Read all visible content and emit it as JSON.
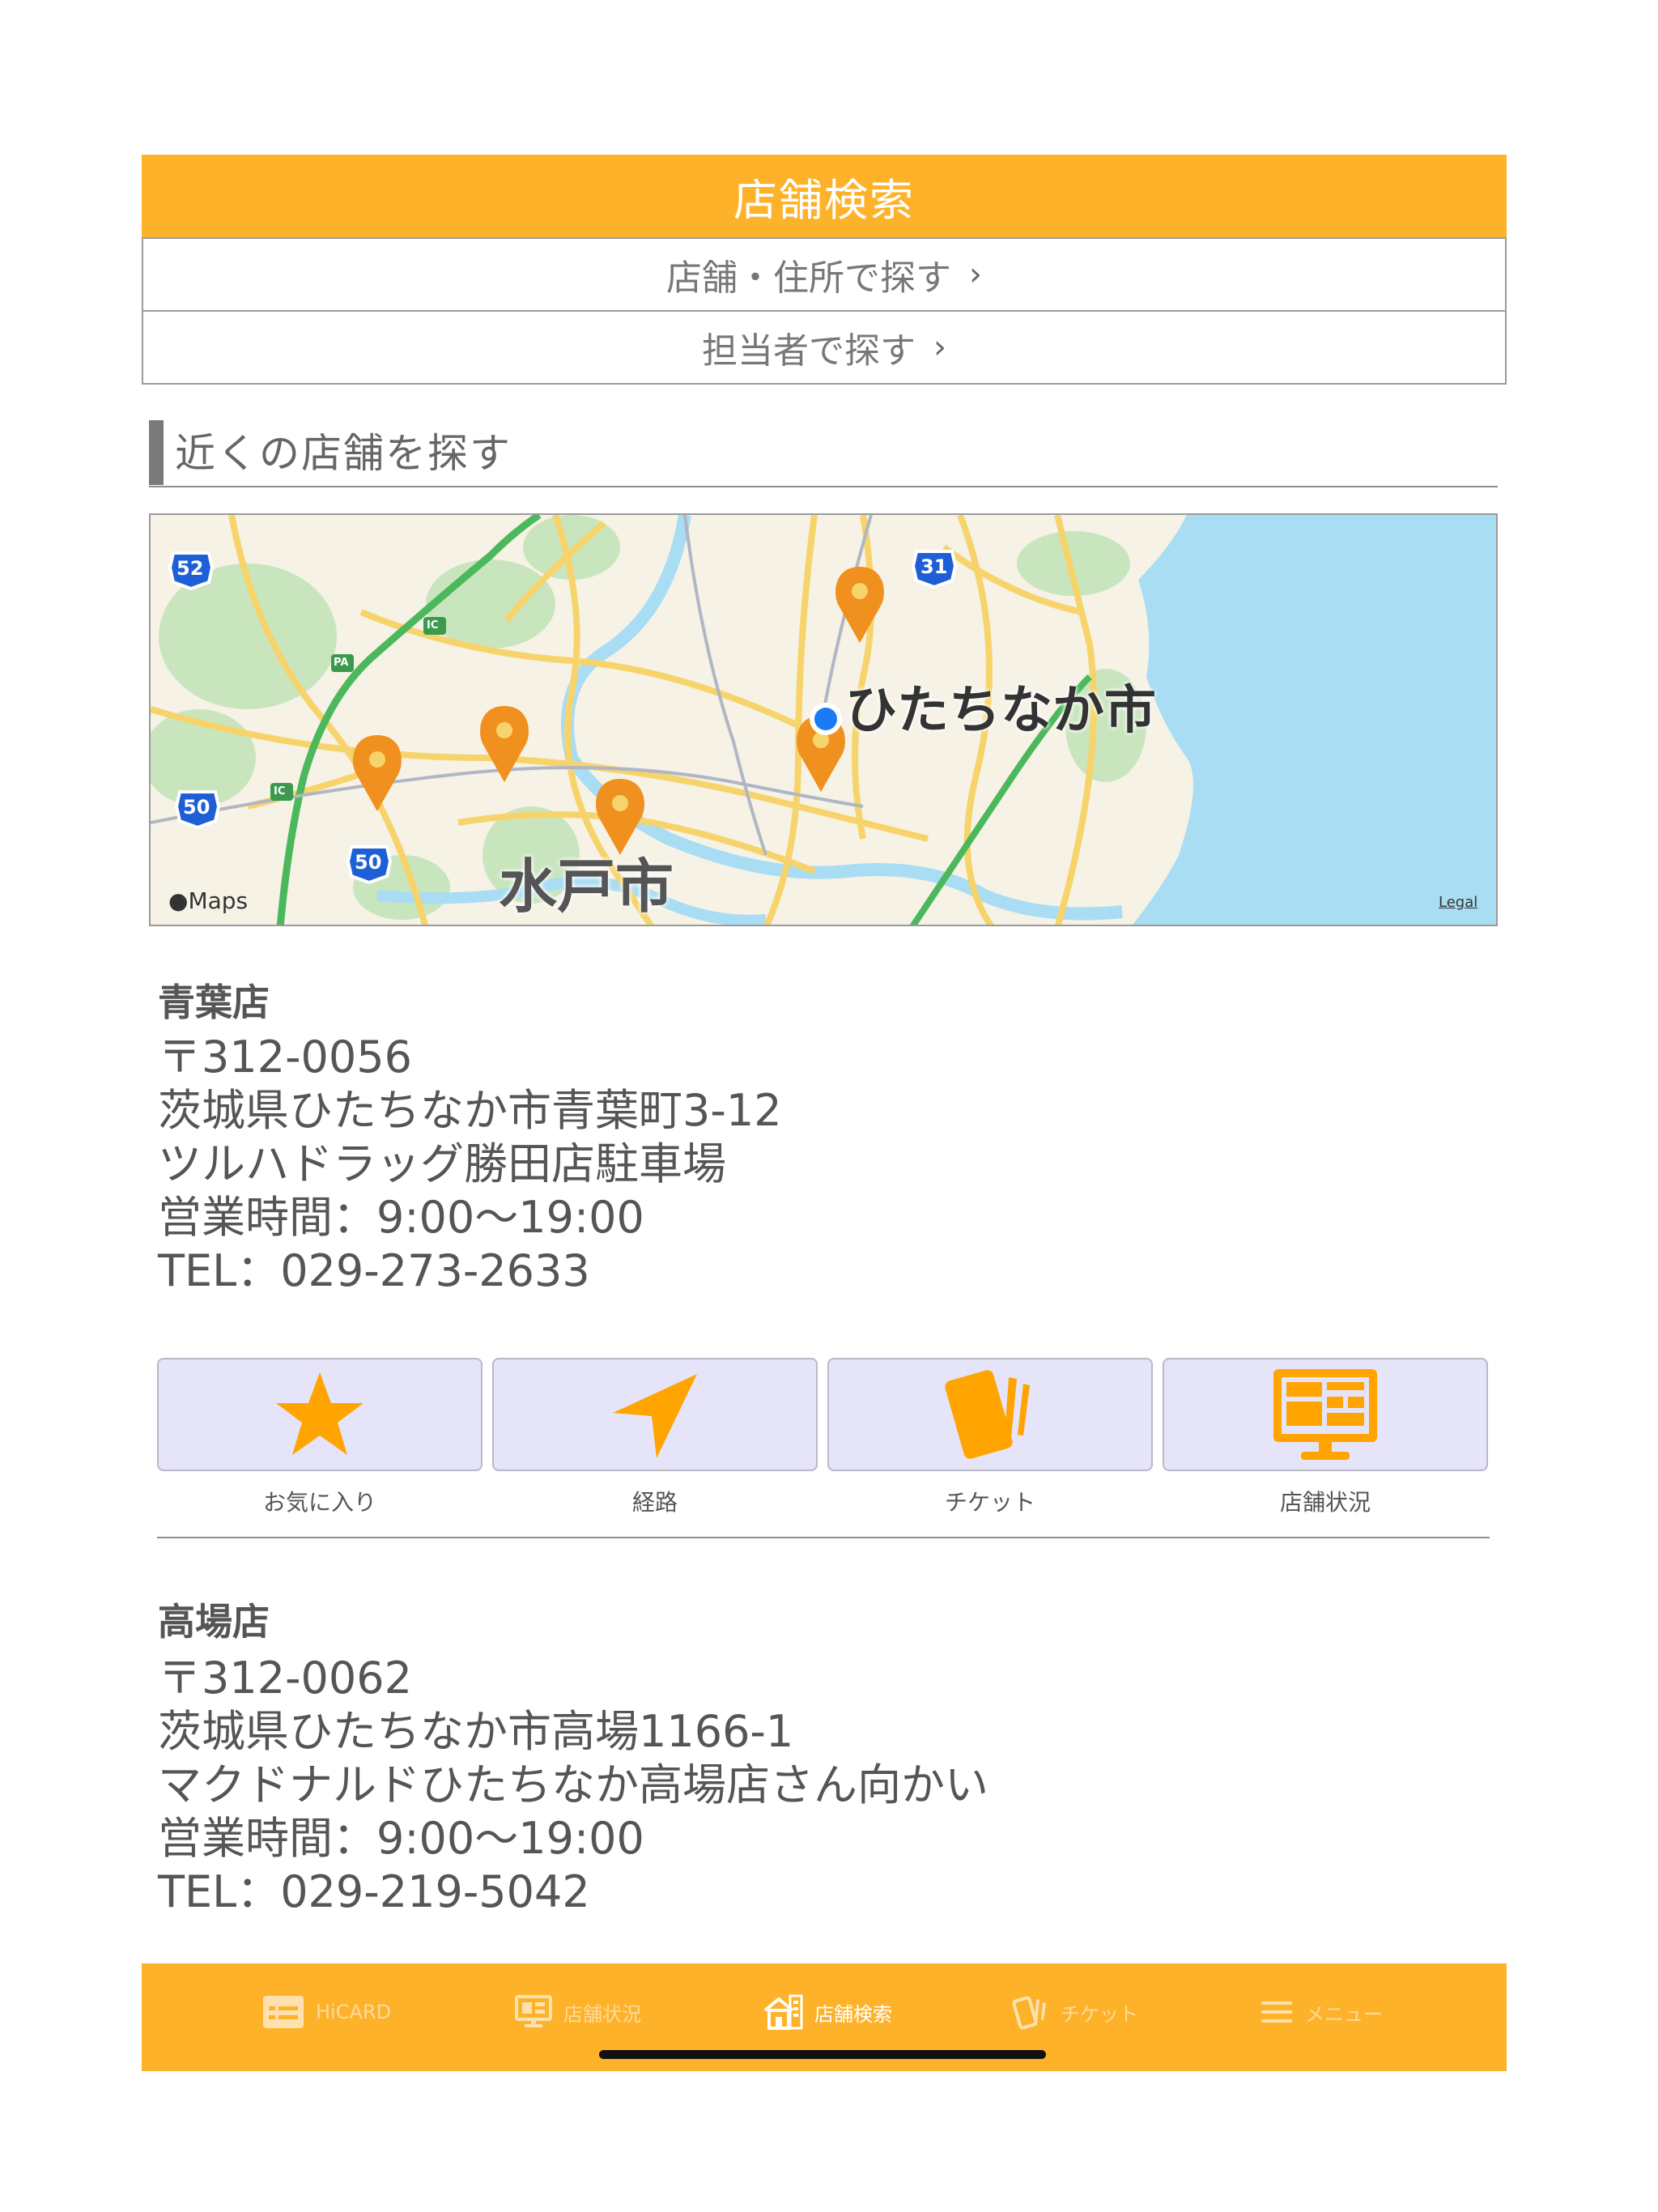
{
  "header": {
    "title": "店舗検索"
  },
  "search_options": [
    {
      "label": "店舗・住所で探す",
      "chevron": "›"
    },
    {
      "label": "担当者で探す",
      "chevron": "›"
    }
  ],
  "nearby": {
    "title": "近くの店舗を探す"
  },
  "map": {
    "city_labels": [
      "ひたちなか市",
      "水戸市"
    ],
    "route_badges": [
      "52",
      "31",
      "50",
      "50"
    ],
    "ic_badges": [
      "IC",
      "PA",
      "IC"
    ],
    "attribution": "Maps",
    "legal": "Legal",
    "pin_color": "#F0901E",
    "location_dot_color": "#1A7CF5",
    "water_color": "#A9DDF3"
  },
  "stores": [
    {
      "name": "青葉店",
      "postal": "〒312-0056",
      "address": "茨城県ひたちなか市青葉町3-12",
      "landmark": "ツルハドラッグ勝田店駐車場",
      "hours": "営業時間：9:00〜19:00",
      "tel": "TEL：029-273-2633"
    },
    {
      "name": "高場店",
      "postal": "〒312-0062",
      "address": "茨城県ひたちなか市高場1166-1",
      "landmark": "マクドナルドひたちなか高場店さん向かい",
      "hours": "営業時間：9:00〜19:00",
      "tel": "TEL：029-219-5042"
    }
  ],
  "actions": [
    {
      "label": "お気に入り",
      "icon": "star-icon"
    },
    {
      "label": "経路",
      "icon": "navigation-arrow-icon"
    },
    {
      "label": "チケット",
      "icon": "ticket-icon"
    },
    {
      "label": "店舗状況",
      "icon": "monitor-icon"
    }
  ],
  "tabbar": [
    {
      "label": "HiCARD",
      "icon": "card-icon",
      "active": false
    },
    {
      "label": "店舗状況",
      "icon": "monitor-icon",
      "active": false
    },
    {
      "label": "店舗検索",
      "icon": "store-icon",
      "active": true
    },
    {
      "label": "チケット",
      "icon": "ticket-icon",
      "active": false
    },
    {
      "label": "メニュー",
      "icon": "hamburger-icon",
      "active": false
    }
  ],
  "colors": {
    "accent": "#FDB22A",
    "button_bg": "#E6E4F8",
    "icon_orange": "#FFA400"
  }
}
